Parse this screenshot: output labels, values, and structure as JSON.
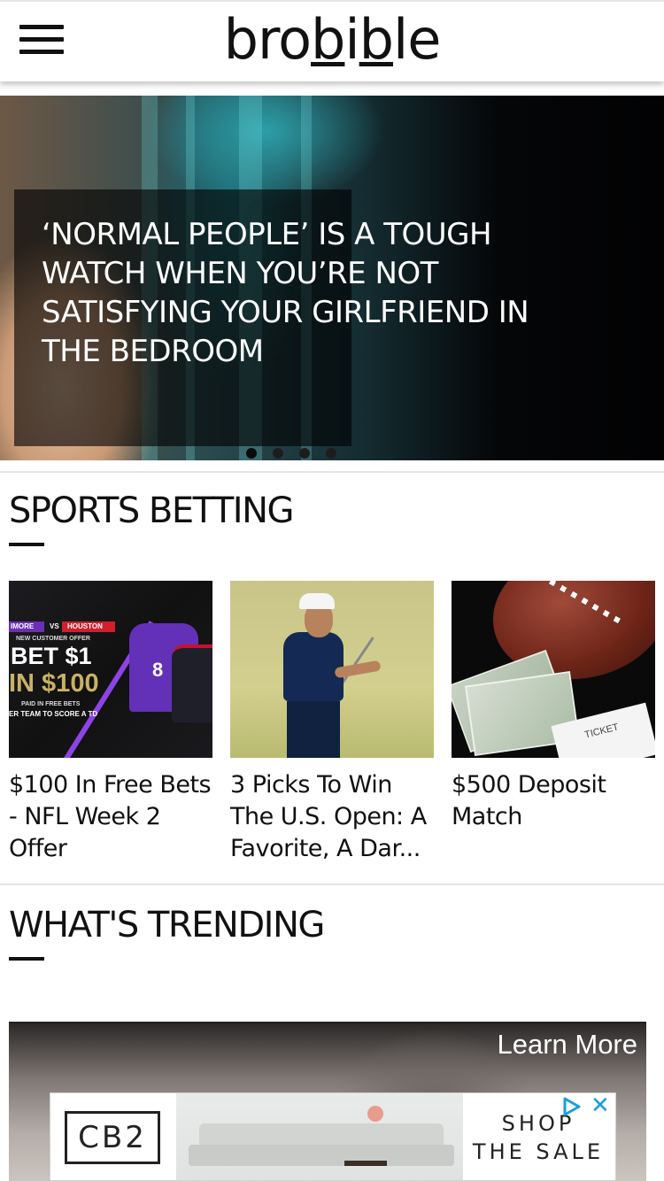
{
  "header": {
    "logo_part1": "bro",
    "logo_b": "b",
    "logo_part2": "i",
    "logo_b2": "b",
    "logo_part3": "le",
    "menu_icon": "hamburger-menu-icon"
  },
  "hero": {
    "title": "‘NORMAL PEOPLE’ IS A TOUGH WATCH WHEN YOU’RE NOT SATISFYING YOUR GIRLFRIEND IN THE BEDROOM",
    "slides_count": 4,
    "active_slide": 1
  },
  "sports_betting": {
    "heading": "SPORTS BETTING",
    "cards": [
      {
        "title": "$100 In Free Bets - NFL Week 2 Offer",
        "image_text": {
          "team_a": "IMORE",
          "vs": "VS",
          "team_b": "HOUSTON",
          "offer": "NEW CUSTOMER OFFER",
          "bet": "BET $1",
          "win": "IN $100",
          "paid": "PAID IN FREE BETS",
          "condition": "ER TEAM TO SCORE A TD",
          "jersey_number": "8"
        }
      },
      {
        "title": "3 Picks To Win The U.S. Open: A Favorite, A Dar..."
      },
      {
        "title": "$500 Deposit Match",
        "image_text": {
          "ticket": "TICKET"
        }
      }
    ]
  },
  "trending": {
    "heading": "WHAT'S TRENDING"
  },
  "ad": {
    "learn_more": "Learn More",
    "brand": "CB2",
    "cta_line1": "SHOP",
    "cta_line2": "THE SALE",
    "close_symbol": "✕",
    "colors": {
      "close": "#18a0d8"
    }
  }
}
